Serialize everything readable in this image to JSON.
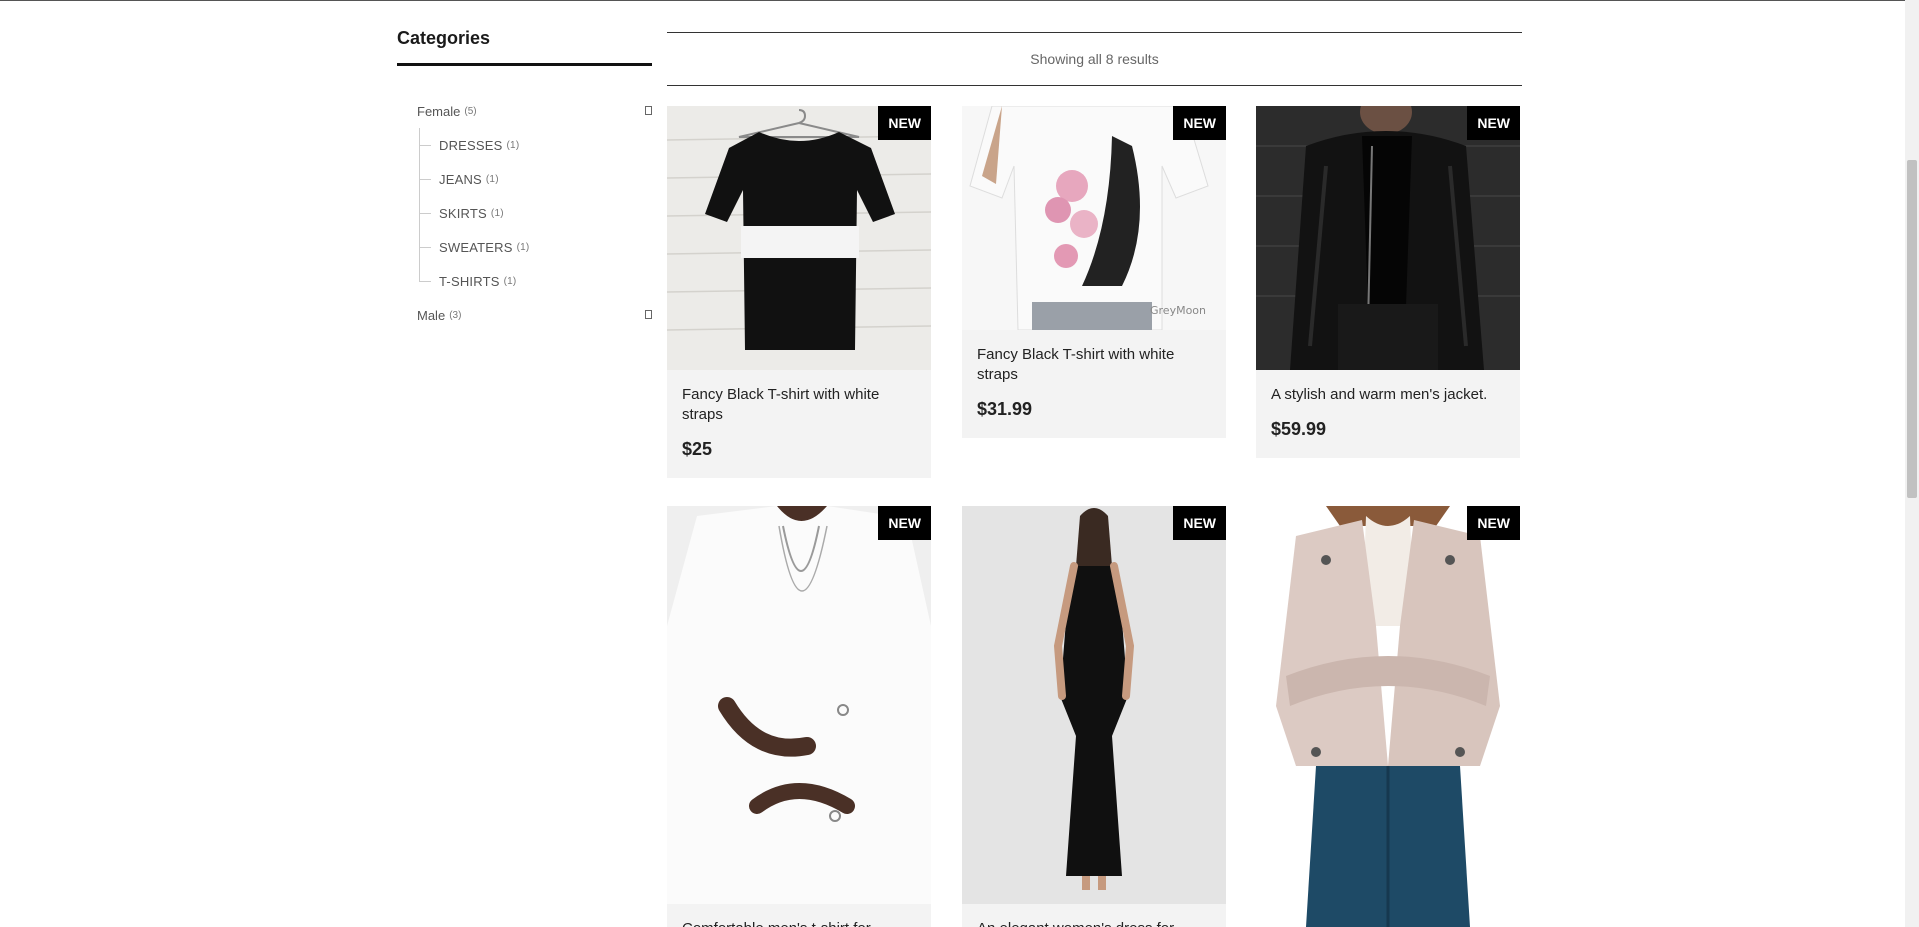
{
  "sidebar": {
    "title": "Categories",
    "categories": [
      {
        "label": "Female",
        "count": "(5)",
        "children": [
          {
            "label": "DRESSES",
            "count": "(1)"
          },
          {
            "label": "JEANS",
            "count": "(1)"
          },
          {
            "label": "SKIRTS",
            "count": "(1)"
          },
          {
            "label": "SWEATERS",
            "count": "(1)"
          },
          {
            "label": "T-SHIRTS",
            "count": "(1)"
          }
        ]
      },
      {
        "label": "Male",
        "count": "(3)",
        "children": []
      }
    ]
  },
  "results": {
    "text": "Showing all 8 results"
  },
  "products": [
    {
      "badge": "NEW",
      "title": "Fancy Black T-shirt with white straps",
      "price": "$25",
      "image": "black-tshirt-white-stripe"
    },
    {
      "badge": "NEW",
      "title": "Fancy Black T-shirt with white straps",
      "price": "$31.99",
      "image": "white-top-floral-heel-print"
    },
    {
      "badge": "NEW",
      "title": "A stylish and warm men's jacket.",
      "price": "$59.99",
      "image": "black-leather-jacket"
    },
    {
      "badge": "NEW",
      "title": "Comfortable men's t-shirt for",
      "price": "",
      "image": "white-tshirt-man"
    },
    {
      "badge": "NEW",
      "title": "An elegant women's dress for",
      "price": "",
      "image": "black-maxi-dress"
    },
    {
      "badge": "NEW",
      "title": "",
      "price": "",
      "image": "pink-leather-jacket"
    }
  ],
  "colors": {
    "badge_bg": "#000000",
    "card_body_bg": "#f3f3f3",
    "accent_text": "#222222"
  }
}
